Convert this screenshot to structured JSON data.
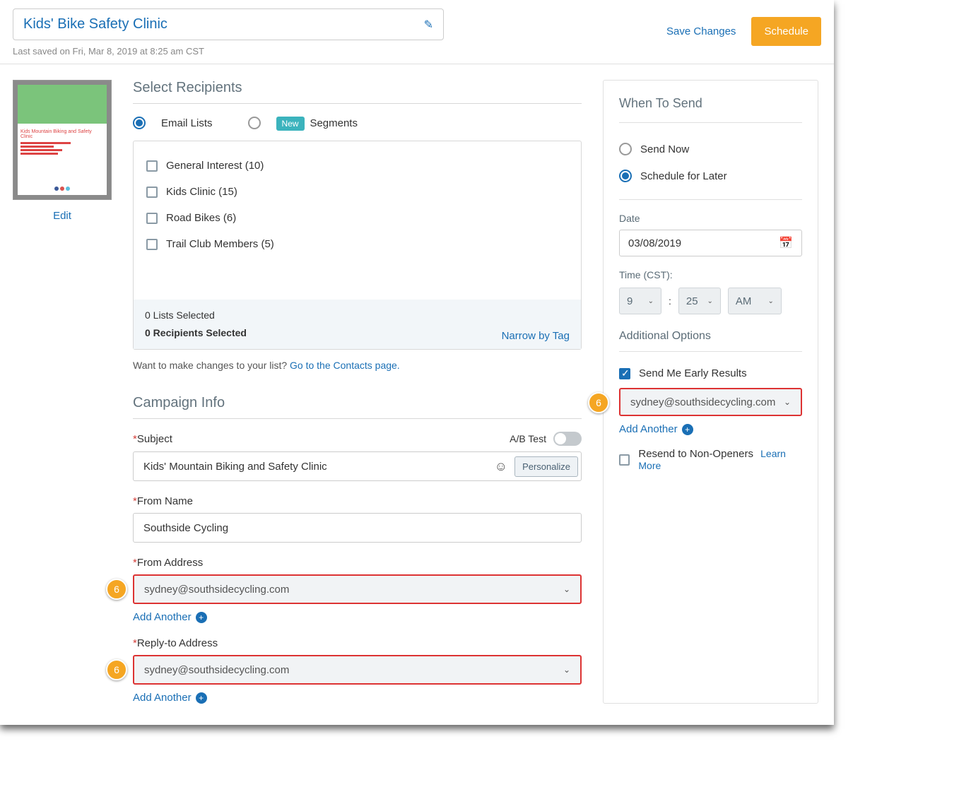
{
  "header": {
    "title": "Kids' Bike Safety Clinic",
    "lastSaved": "Last saved on Fri, Mar 8, 2019 at 8:25 am CST",
    "saveChanges": "Save Changes",
    "schedule": "Schedule"
  },
  "leftCol": {
    "edit": "Edit"
  },
  "recipients": {
    "heading": "Select Recipients",
    "tabEmailLists": "Email Lists",
    "tabSegments": "Segments",
    "newPill": "New",
    "lists": {
      "0": "General Interest (10)",
      "1": "Kids Clinic (15)",
      "2": "Road Bikes (6)",
      "3": "Trail Club Members (5)"
    },
    "listsSelected": "0 Lists Selected",
    "recipientsSelected": "0 Recipients Selected",
    "narrowByTag": "Narrow by Tag",
    "helperPrefix": "Want to make changes to your list? ",
    "helperLink": "Go to the Contacts page."
  },
  "campaign": {
    "heading": "Campaign Info",
    "subjectLabel": "Subject",
    "abTestLabel": "A/B Test",
    "subjectValue": "Kids' Mountain Biking and Safety Clinic",
    "personalize": "Personalize",
    "fromNameLabel": "From Name",
    "fromNameValue": "Southside Cycling",
    "fromAddressLabel": "From Address",
    "fromAddressValue": "sydney@southsidecycling.com",
    "replyToLabel": "Reply-to Address",
    "replyToValue": "sydney@southsidecycling.com",
    "addAnother": "Add Another"
  },
  "whenToSend": {
    "heading": "When To Send",
    "sendNow": "Send Now",
    "scheduleLater": "Schedule for Later",
    "dateLabel": "Date",
    "dateValue": "03/08/2019",
    "timeLabel": "Time (CST):",
    "hour": "9",
    "minute": "25",
    "ampm": "AM",
    "additionalOptions": "Additional Options",
    "sendEarly": "Send Me Early Results",
    "earlyEmail": "sydney@southsidecycling.com",
    "addAnother": "Add Another",
    "resendNonOpeners": "Resend to Non-Openers",
    "learnMore": "Learn More"
  },
  "badges": {
    "six": "6"
  }
}
